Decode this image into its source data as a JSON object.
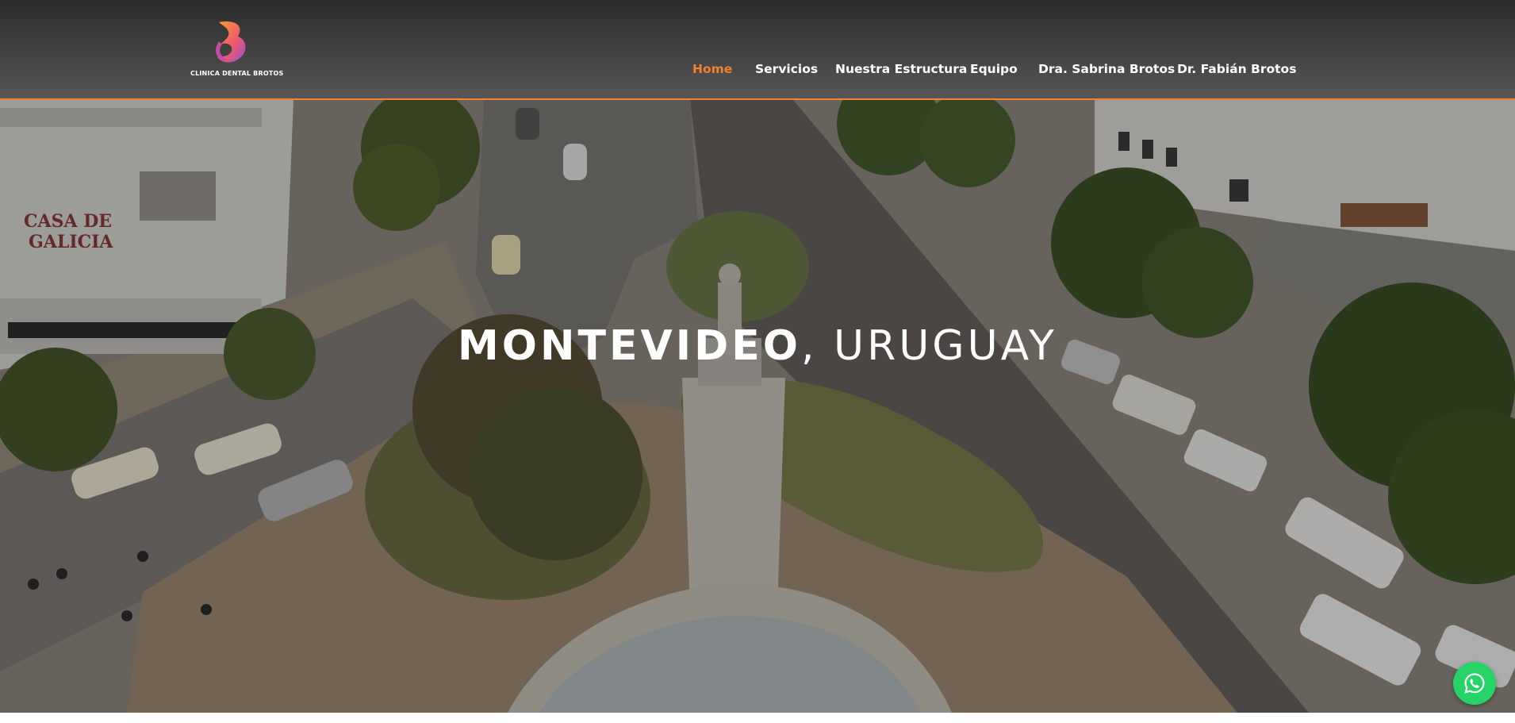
{
  "brand": {
    "logo_text": "CLINICA DENTAL BROTOS",
    "accent_color": "#f2832e"
  },
  "nav": {
    "items": [
      {
        "label": "Home",
        "active": true
      },
      {
        "label": "Servicios",
        "active": false
      },
      {
        "label": "Nuestra Estructura",
        "active": false
      },
      {
        "label": "Equipo",
        "active": false
      },
      {
        "label": "Dra. Sabrina Brotos",
        "active": false
      },
      {
        "label": "Dr. Fabián Brotos",
        "active": false
      }
    ]
  },
  "hero": {
    "title_strong": "MONTEVIDEO",
    "title_light": ", URUGUAY",
    "sign_text": "CASA DE GALICIA"
  },
  "whatsapp": {
    "icon": "whatsapp-icon",
    "color": "#25d366"
  }
}
